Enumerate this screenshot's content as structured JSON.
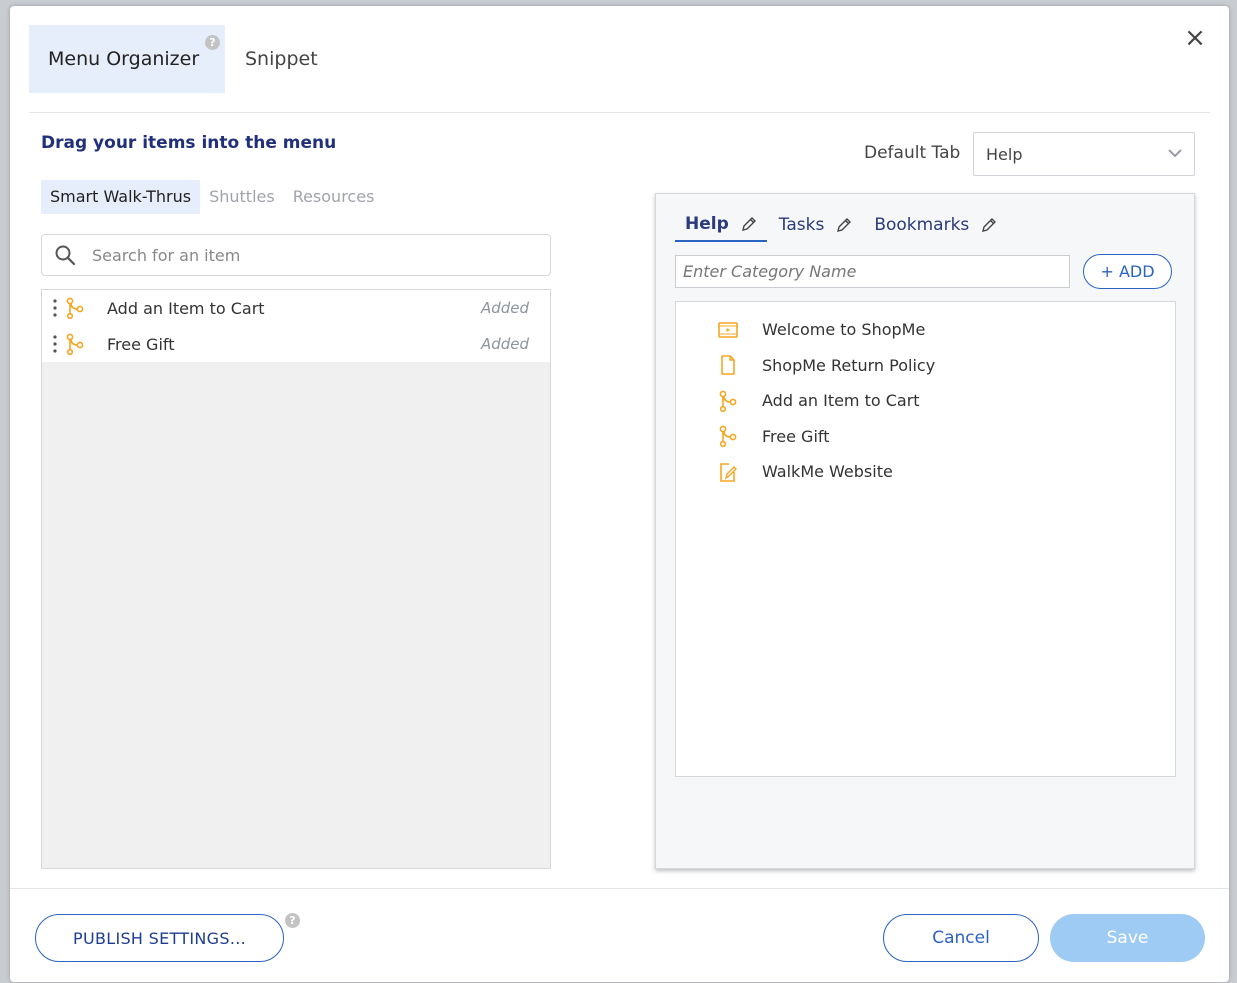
{
  "header": {
    "tabs": [
      {
        "label": "Menu Organizer",
        "active": true
      },
      {
        "label": "Snippet",
        "active": false
      }
    ],
    "help_glyph": "?",
    "close_glyph": "×"
  },
  "left": {
    "heading": "Drag your items into the menu",
    "sub_tabs": [
      {
        "label": "Smart Walk-Thrus",
        "active": true
      },
      {
        "label": "Shuttles",
        "active": false
      },
      {
        "label": "Resources",
        "active": false
      }
    ],
    "search_placeholder": "Search for an item",
    "items": [
      {
        "label": "Add an Item to Cart",
        "status": "Added"
      },
      {
        "label": "Free Gift",
        "status": "Added"
      }
    ]
  },
  "right": {
    "default_tab_label": "Default Tab",
    "default_tab_value": "Help",
    "menu_tabs": [
      {
        "label": "Help",
        "active": true
      },
      {
        "label": "Tasks",
        "active": false
      },
      {
        "label": "Bookmarks",
        "active": false
      }
    ],
    "category_placeholder": "Enter Category Name",
    "add_label": "+ ADD",
    "items": [
      {
        "label": "Welcome to ShopMe",
        "icon": "video-icon"
      },
      {
        "label": "ShopMe Return Policy",
        "icon": "document-icon"
      },
      {
        "label": "Add an Item to Cart",
        "icon": "walkthru-icon"
      },
      {
        "label": "Free Gift",
        "icon": "walkthru-icon"
      },
      {
        "label": "WalkMe Website",
        "icon": "link-icon"
      }
    ]
  },
  "footer": {
    "publish_label": "PUBLISH SETTINGS...",
    "cancel_label": "Cancel",
    "save_label": "Save"
  },
  "colors": {
    "accent": "#2a63c2",
    "heading": "#21307a",
    "icon_orange": "#f5a623",
    "save_disabled": "#9ecbf3"
  }
}
